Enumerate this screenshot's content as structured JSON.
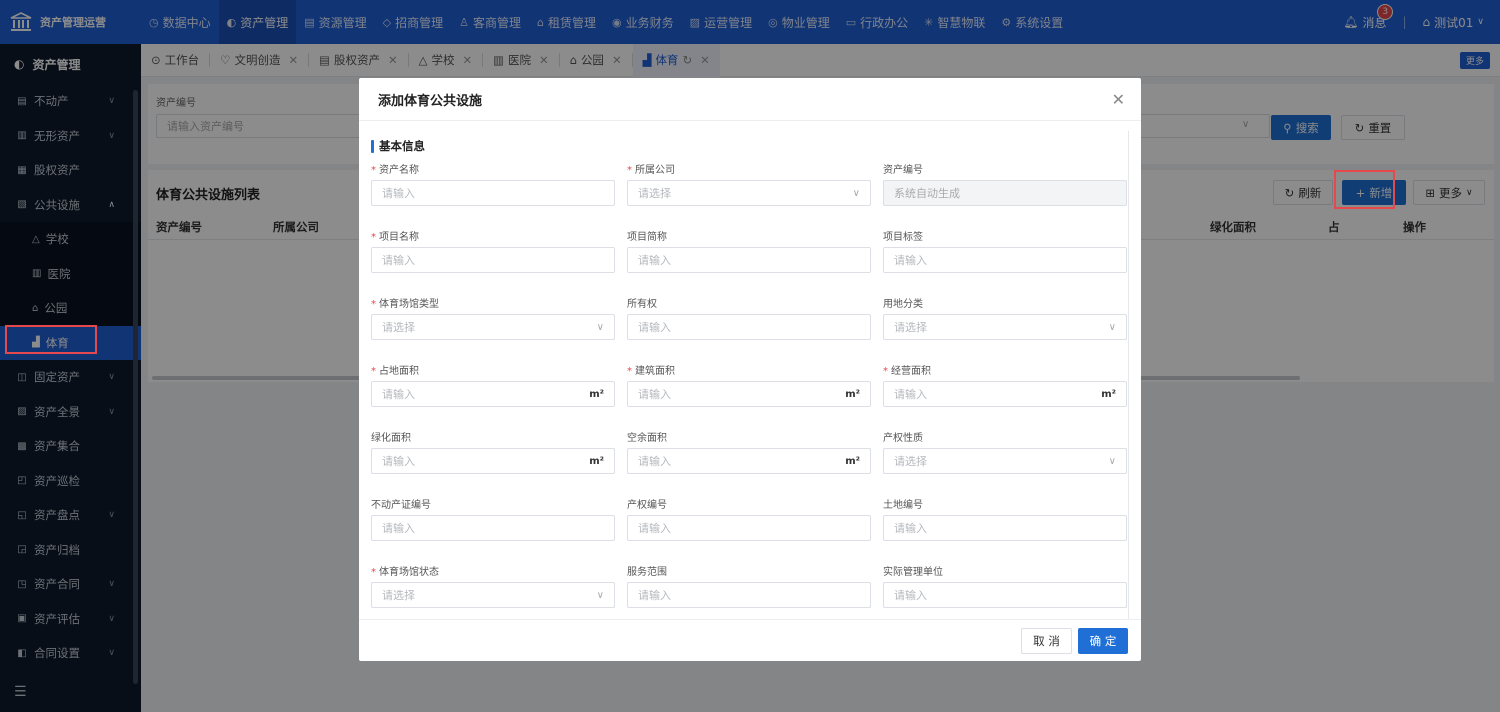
{
  "app": {
    "title": "资产管理运营"
  },
  "topnav": [
    {
      "icon": "◷",
      "label": "数据中心"
    },
    {
      "icon": "◐",
      "label": "资产管理",
      "active": true
    },
    {
      "icon": "▤",
      "label": "资源管理"
    },
    {
      "icon": "◇",
      "label": "招商管理"
    },
    {
      "icon": "♙",
      "label": "客商管理"
    },
    {
      "icon": "⌂",
      "label": "租赁管理"
    },
    {
      "icon": "◉",
      "label": "业务财务"
    },
    {
      "icon": "▨",
      "label": "运营管理"
    },
    {
      "icon": "◎",
      "label": "物业管理"
    },
    {
      "icon": "▭",
      "label": "行政办公"
    },
    {
      "icon": "✳",
      "label": "智慧物联"
    },
    {
      "icon": "⚙",
      "label": "系统设置"
    }
  ],
  "topright": {
    "messages_label": "消息",
    "messages_count": "3",
    "user": "测试01"
  },
  "sidebar": {
    "header": "资产管理",
    "items_top": [
      {
        "label": "不动产",
        "expandable": true
      },
      {
        "label": "无形资产",
        "expandable": true
      },
      {
        "label": "股权资产",
        "expandable": false
      },
      {
        "label": "公共设施",
        "expandable": true,
        "open": true
      }
    ],
    "sub_items": [
      {
        "label": "学校"
      },
      {
        "label": "医院"
      },
      {
        "label": "公园"
      },
      {
        "label": "体育",
        "active": true
      }
    ],
    "items_bottom": [
      {
        "label": "固定资产",
        "expandable": true
      },
      {
        "label": "资产全景",
        "expandable": true
      },
      {
        "label": "资产集合",
        "expandable": false
      },
      {
        "label": "资产巡检",
        "expandable": false
      },
      {
        "label": "资产盘点",
        "expandable": true
      },
      {
        "label": "资产归档",
        "expandable": false
      },
      {
        "label": "资产合同",
        "expandable": true
      },
      {
        "label": "资产评估",
        "expandable": true
      },
      {
        "label": "合同设置",
        "expandable": true
      }
    ]
  },
  "tabs": [
    {
      "label": "工作台",
      "closable": false
    },
    {
      "label": "文明创造",
      "closable": true
    },
    {
      "label": "股权资产",
      "closable": true
    },
    {
      "label": "学校",
      "closable": true
    },
    {
      "label": "医院",
      "closable": true
    },
    {
      "label": "公园",
      "closable": true
    },
    {
      "label": "体育",
      "closable": true,
      "active": true
    }
  ],
  "tabs_more": "更多",
  "search": {
    "field_label": "资产编号",
    "placeholder": "请输入资产编号",
    "search_btn": "搜索",
    "reset_btn": "重置"
  },
  "list": {
    "title": "体育公共设施列表",
    "refresh_btn": "刷新",
    "add_btn": "新增",
    "more_btn": "更多",
    "columns": {
      "c1": "资产编号",
      "c2": "所属公司",
      "c3": "绿化面积",
      "c4": "占",
      "c5": "操作"
    }
  },
  "modal": {
    "title": "添加体育公共设施",
    "section": "基本信息",
    "fields": [
      {
        "label": "资产名称",
        "required": true,
        "placeholder": "请输入",
        "type": "text"
      },
      {
        "label": "所属公司",
        "required": true,
        "placeholder": "请选择",
        "type": "select"
      },
      {
        "label": "资产编号",
        "required": false,
        "placeholder": "系统自动生成",
        "type": "disabled"
      },
      {
        "label": "项目名称",
        "required": true,
        "placeholder": "请输入",
        "type": "text"
      },
      {
        "label": "项目简称",
        "required": false,
        "placeholder": "请输入",
        "type": "text"
      },
      {
        "label": "项目标签",
        "required": false,
        "placeholder": "请输入",
        "type": "text"
      },
      {
        "label": "体育场馆类型",
        "required": true,
        "placeholder": "请选择",
        "type": "select"
      },
      {
        "label": "所有权",
        "required": false,
        "placeholder": "请输入",
        "type": "text"
      },
      {
        "label": "用地分类",
        "required": false,
        "placeholder": "请选择",
        "type": "select"
      },
      {
        "label": "占地面积",
        "required": true,
        "placeholder": "请输入",
        "type": "area",
        "suffix": "m²"
      },
      {
        "label": "建筑面积",
        "required": true,
        "placeholder": "请输入",
        "type": "area",
        "suffix": "m²"
      },
      {
        "label": "经营面积",
        "required": true,
        "placeholder": "请输入",
        "type": "area",
        "suffix": "m²"
      },
      {
        "label": "绿化面积",
        "required": false,
        "placeholder": "请输入",
        "type": "area",
        "suffix": "m²"
      },
      {
        "label": "空余面积",
        "required": false,
        "placeholder": "请输入",
        "type": "area",
        "suffix": "m²"
      },
      {
        "label": "产权性质",
        "required": false,
        "placeholder": "请选择",
        "type": "select"
      },
      {
        "label": "不动产证编号",
        "required": false,
        "placeholder": "请输入",
        "type": "text"
      },
      {
        "label": "产权编号",
        "required": false,
        "placeholder": "请输入",
        "type": "text"
      },
      {
        "label": "土地编号",
        "required": false,
        "placeholder": "请输入",
        "type": "text"
      },
      {
        "label": "体育场馆状态",
        "required": true,
        "placeholder": "请选择",
        "type": "select"
      },
      {
        "label": "服务范围",
        "required": false,
        "placeholder": "请输入",
        "type": "text"
      },
      {
        "label": "实际管理单位",
        "required": false,
        "placeholder": "请输入",
        "type": "text"
      }
    ],
    "cancel_btn": "取 消",
    "ok_btn": "确 定"
  },
  "colors": {
    "primary": "#1f5fd6",
    "sidebar_bg": "#0f1b2d",
    "required": "#e5484d"
  }
}
